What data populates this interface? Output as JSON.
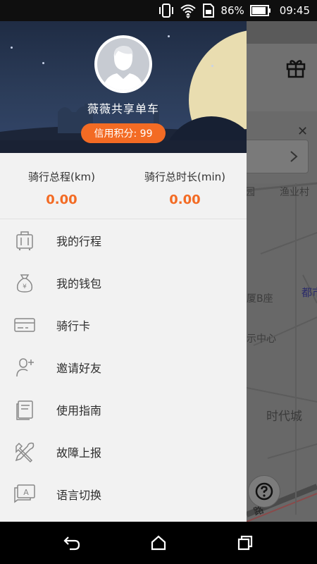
{
  "status_bar": {
    "battery_percent": "86%",
    "time": "09:45"
  },
  "drawer": {
    "username": "薇薇共享单车",
    "credit": "信用积分: 99",
    "stats": [
      {
        "label": "骑行总程(km)",
        "value": "0.00"
      },
      {
        "label": "骑行总时长(min)",
        "value": "0.00"
      }
    ],
    "menu": [
      {
        "label": "我的行程",
        "icon": "luggage-icon"
      },
      {
        "label": "我的钱包",
        "icon": "money-bag-icon"
      },
      {
        "label": "骑行卡",
        "icon": "card-icon"
      },
      {
        "label": "邀请好友",
        "icon": "add-user-icon"
      },
      {
        "label": "使用指南",
        "icon": "guide-book-icon"
      },
      {
        "label": "故障上报",
        "icon": "tools-icon"
      },
      {
        "label": "语言切换",
        "icon": "language-icon"
      }
    ]
  },
  "map": {
    "labels": {
      "fishing_village": "渔业村",
      "partial_yuan": "园",
      "building_b": "厦B座",
      "center": "示中心",
      "city_partial": "都市",
      "times_city": "时代城",
      "road": "路"
    }
  },
  "colors": {
    "accent": "#f36b24",
    "header_bg": "#2c3d5a",
    "drawer_bg": "#f2f2f2"
  }
}
